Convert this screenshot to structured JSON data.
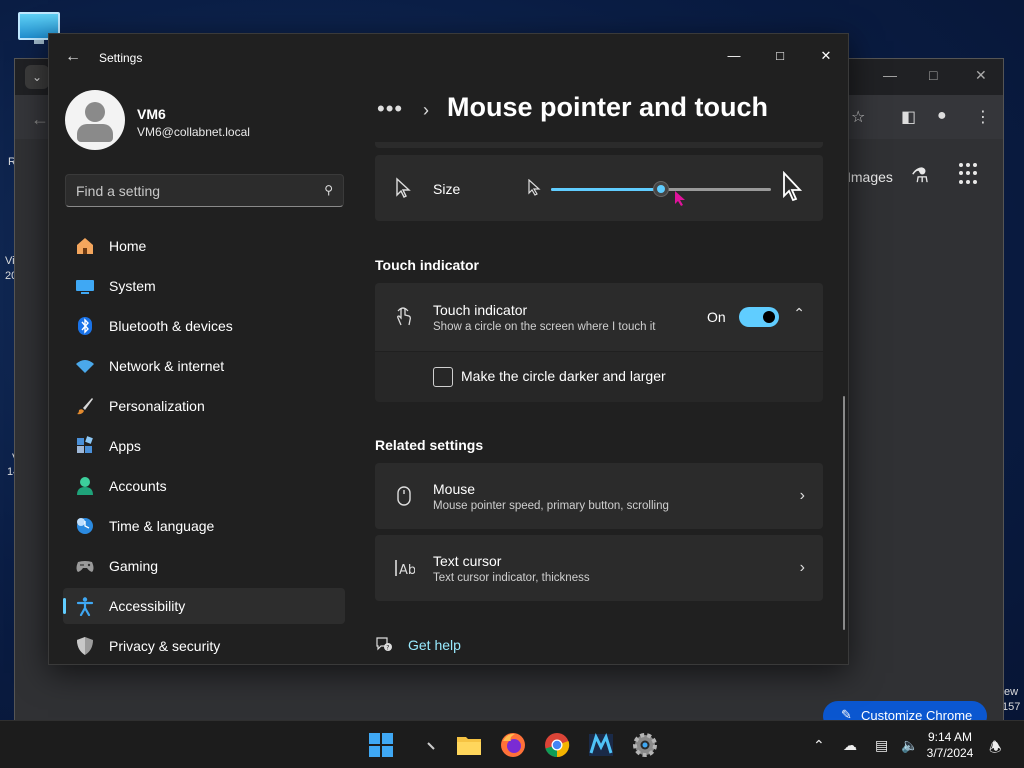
{
  "desktop": {
    "left_fragments": [
      "R",
      "Vi",
      "20",
      "V",
      "14"
    ],
    "right_fragments": [
      "ew",
      "157"
    ]
  },
  "chrome": {
    "images_link": "Images",
    "customize_label": "Customize Chrome"
  },
  "settings": {
    "window_title": "Settings",
    "user": {
      "name": "VM6",
      "email": "VM6@collabnet.local"
    },
    "search": {
      "placeholder": "Find a setting",
      "value": ""
    },
    "nav": [
      {
        "label": "Home",
        "icon": "home-icon"
      },
      {
        "label": "System",
        "icon": "system-icon"
      },
      {
        "label": "Bluetooth & devices",
        "icon": "bluetooth-icon"
      },
      {
        "label": "Network & internet",
        "icon": "wifi-icon"
      },
      {
        "label": "Personalization",
        "icon": "brush-icon"
      },
      {
        "label": "Apps",
        "icon": "apps-icon"
      },
      {
        "label": "Accounts",
        "icon": "accounts-icon"
      },
      {
        "label": "Time & language",
        "icon": "globe-clock-icon"
      },
      {
        "label": "Gaming",
        "icon": "gamepad-icon"
      },
      {
        "label": "Accessibility",
        "icon": "accessibility-icon",
        "active": true
      },
      {
        "label": "Privacy & security",
        "icon": "shield-icon"
      }
    ],
    "breadcrumb": {
      "overflow": "•••",
      "separator": "›",
      "page_title": "Mouse pointer and touch"
    },
    "size_card": {
      "label": "Size",
      "slider_value": 0.5
    },
    "touch_section": {
      "heading": "Touch indicator",
      "title": "Touch indicator",
      "description": "Show a circle on the screen where I touch it",
      "state_label": "On",
      "toggle_on": true,
      "checkbox_label": "Make the circle darker and larger",
      "checkbox_checked": false
    },
    "related": {
      "heading": "Related settings",
      "items": [
        {
          "title": "Mouse",
          "description": "Mouse pointer speed, primary button, scrolling"
        },
        {
          "title": "Text cursor",
          "description": "Text cursor indicator, thickness"
        }
      ]
    },
    "help": "Get help"
  },
  "taskbar": {
    "clock_time": "9:14 AM",
    "clock_date": "3/7/2024"
  },
  "colors": {
    "accent": "#60cdff",
    "settings_bg": "#202020",
    "card_bg": "#2b2b2b"
  }
}
